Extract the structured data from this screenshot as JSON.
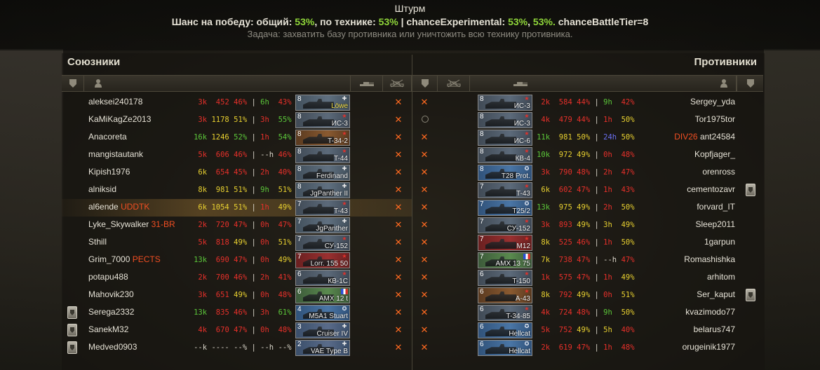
{
  "header": {
    "title": "Штурм",
    "chance_label": "Шанс на победу: общий:",
    "chance_general": "53%",
    "chance_tech_label": ", по технике:",
    "chance_tech": "53%",
    "chance_sep": "| chanceExperimental:",
    "chance_exp1": "53%",
    "chance_comma": ",",
    "chance_exp2": "53%.",
    "chance_tier": "chanceBattleTier=8",
    "task": "Задача: захватить базу противника или уничтожить всю технику противника."
  },
  "teams": {
    "allies_title": "Союзники",
    "enemies_title": "Противники"
  },
  "allies": [
    {
      "name": "aleksei240178",
      "clan": "",
      "battles": "3k",
      "eff": "452",
      "wr": "46%",
      "sep": "|",
      "tb": "6h",
      "twr": "43%",
      "c": [
        "s-red",
        "s-red",
        "s-red",
        "s-green",
        "s-red"
      ],
      "tier": "8",
      "tank": "Löwe",
      "nation": "ger",
      "gold": true,
      "medal": false
    },
    {
      "name": "KaMiKagZe2013",
      "clan": "",
      "battles": "3k",
      "eff": "1178",
      "wr": "51%",
      "sep": "|",
      "tb": "3h",
      "twr": "55%",
      "c": [
        "s-red",
        "s-yellow",
        "s-yellow",
        "s-red",
        "s-green"
      ],
      "tier": "8",
      "tank": "ИС-3",
      "nation": "ussr",
      "gold": false,
      "medal": false
    },
    {
      "name": "Anacoreta",
      "clan": "",
      "battles": "16k",
      "eff": "1246",
      "wr": "52%",
      "sep": "|",
      "tb": "1h",
      "twr": "54%",
      "c": [
        "s-green",
        "s-yellow",
        "s-green",
        "s-red",
        "s-green"
      ],
      "tier": "8",
      "tank": "T-34-2",
      "nation": "chn",
      "gold": false,
      "medal": false
    },
    {
      "name": "mangistautank",
      "clan": "",
      "battles": "5k",
      "eff": "606",
      "wr": "46%",
      "sep": "|",
      "tb": "--h",
      "twr": "46%",
      "c": [
        "s-red",
        "s-red",
        "s-red",
        "s-white",
        "s-red"
      ],
      "tier": "8",
      "tank": "T-44",
      "nation": "ussr",
      "gold": false,
      "medal": false
    },
    {
      "name": "Kipish1976",
      "clan": "",
      "battles": "6k",
      "eff": "654",
      "wr": "45%",
      "sep": "|",
      "tb": "2h",
      "twr": "40%",
      "c": [
        "s-yellow",
        "s-red",
        "s-red",
        "s-red",
        "s-red"
      ],
      "tier": "8",
      "tank": "Ferdinand",
      "nation": "ger",
      "gold": false,
      "medal": false
    },
    {
      "name": "alniksid",
      "clan": "",
      "battles": "8k",
      "eff": "981",
      "wr": "51%",
      "sep": "|",
      "tb": "9h",
      "twr": "51%",
      "c": [
        "s-yellow",
        "s-yellow",
        "s-yellow",
        "s-green",
        "s-yellow"
      ],
      "tier": "8",
      "tank": "JgPanther II",
      "nation": "ger",
      "gold": false,
      "medal": false
    },
    {
      "name": "al6ende",
      "clan": "UDDTK",
      "battles": "6k",
      "eff": "1054",
      "wr": "51%",
      "sep": "|",
      "tb": "1h",
      "twr": "49%",
      "c": [
        "s-yellow",
        "s-yellow",
        "s-yellow",
        "s-red",
        "s-yellow"
      ],
      "tier": "7",
      "tank": "T-43",
      "nation": "ussr",
      "gold": false,
      "medal": false,
      "highlight": true
    },
    {
      "name": "Lyke_Skywalker",
      "clan": "31-BR",
      "battles": "2k",
      "eff": "720",
      "wr": "47%",
      "sep": "|",
      "tb": "0h",
      "twr": "47%",
      "c": [
        "s-red",
        "s-red",
        "s-red",
        "s-red",
        "s-red"
      ],
      "tier": "7",
      "tank": "JgPanther",
      "nation": "ger",
      "gold": false,
      "medal": false
    },
    {
      "name": "Sthill",
      "clan": "",
      "battles": "5k",
      "eff": "818",
      "wr": "49%",
      "sep": "|",
      "tb": "0h",
      "twr": "51%",
      "c": [
        "s-red",
        "s-red",
        "s-yellow",
        "s-red",
        "s-yellow"
      ],
      "tier": "7",
      "tank": "СУ-152",
      "nation": "ussr",
      "gold": false,
      "medal": false
    },
    {
      "name": "Grim_7000",
      "clan": "PECTS",
      "battles": "13k",
      "eff": "690",
      "wr": "47%",
      "sep": "|",
      "tb": "0h",
      "twr": "49%",
      "c": [
        "s-green",
        "s-red",
        "s-red",
        "s-red",
        "s-yellow"
      ],
      "tier": "7",
      "tank": "Lorr. 155 50",
      "nation": "jpn",
      "gold": false,
      "medal": false
    },
    {
      "name": "potapu488",
      "clan": "",
      "battles": "2k",
      "eff": "700",
      "wr": "46%",
      "sep": "|",
      "tb": "2h",
      "twr": "41%",
      "c": [
        "s-red",
        "s-red",
        "s-red",
        "s-red",
        "s-red"
      ],
      "tier": "6",
      "tank": "КВ-1С",
      "nation": "ussr",
      "gold": false,
      "medal": false
    },
    {
      "name": "Mahovik230",
      "clan": "",
      "battles": "3k",
      "eff": "651",
      "wr": "49%",
      "sep": "|",
      "tb": "0h",
      "twr": "48%",
      "c": [
        "s-red",
        "s-red",
        "s-yellow",
        "s-red",
        "s-red"
      ],
      "tier": "6",
      "tank": "AMX 12 t",
      "nation": "fra",
      "gold": false,
      "medal": false
    },
    {
      "name": "Serega2332",
      "clan": "",
      "battles": "13k",
      "eff": "835",
      "wr": "46%",
      "sep": "|",
      "tb": "3h",
      "twr": "61%",
      "c": [
        "s-green",
        "s-red",
        "s-red",
        "s-red",
        "s-green"
      ],
      "tier": "4",
      "tank": "M5A1 Stuart",
      "nation": "usa",
      "gold": false,
      "medal": true
    },
    {
      "name": "SanekM32",
      "clan": "",
      "battles": "4k",
      "eff": "670",
      "wr": "47%",
      "sep": "|",
      "tb": "0h",
      "twr": "48%",
      "c": [
        "s-red",
        "s-red",
        "s-red",
        "s-red",
        "s-red"
      ],
      "tier": "3",
      "tank": "Cruiser IV",
      "nation": "uk",
      "gold": false,
      "medal": true
    },
    {
      "name": "Medved0903",
      "clan": "",
      "battles": "--k",
      "eff": "----",
      "wr": "--%",
      "sep": "|",
      "tb": "--h",
      "twr": "--%",
      "c": [
        "s-white",
        "s-white",
        "s-white",
        "s-white",
        "s-white"
      ],
      "tier": "2",
      "tank": "VAE Type B",
      "nation": "uk",
      "gold": false,
      "medal": true
    }
  ],
  "enemies": [
    {
      "name": "Sergey_yda",
      "battles": "2k",
      "eff": "584",
      "wr": "44%",
      "sep": "|",
      "tb": "9h",
      "twr": "42%",
      "c": [
        "s-red",
        "s-red",
        "s-red",
        "s-green",
        "s-red"
      ],
      "tier": "8",
      "tank": "ИС-3",
      "nation": "ussr",
      "status": "x",
      "clan": "",
      "medal": false
    },
    {
      "name": "Tor1975tor",
      "battles": "4k",
      "eff": "479",
      "wr": "44%",
      "sep": "|",
      "tb": "1h",
      "twr": "50%",
      "c": [
        "s-red",
        "s-red",
        "s-red",
        "s-red",
        "s-yellow"
      ],
      "tier": "8",
      "tank": "ИС-3",
      "nation": "ussr",
      "status": "o",
      "clan": "",
      "medal": false
    },
    {
      "name": "ant24584",
      "battles": "11k",
      "eff": "981",
      "wr": "50%",
      "sep": "|",
      "tb": "24h",
      "twr": "50%",
      "c": [
        "s-green",
        "s-yellow",
        "s-yellow",
        "s-blue",
        "s-yellow"
      ],
      "tier": "8",
      "tank": "ИС-6",
      "nation": "ussr",
      "status": "x",
      "clan": "DIV26",
      "medal": false
    },
    {
      "name": "Kopfjager_",
      "battles": "10k",
      "eff": "972",
      "wr": "49%",
      "sep": "|",
      "tb": "0h",
      "twr": "48%",
      "c": [
        "s-green",
        "s-yellow",
        "s-yellow",
        "s-red",
        "s-red"
      ],
      "tier": "8",
      "tank": "КВ-4",
      "nation": "ussr",
      "status": "x",
      "clan": "",
      "medal": false
    },
    {
      "name": "orenross",
      "battles": "3k",
      "eff": "790",
      "wr": "48%",
      "sep": "|",
      "tb": "2h",
      "twr": "47%",
      "c": [
        "s-red",
        "s-red",
        "s-red",
        "s-red",
        "s-red"
      ],
      "tier": "8",
      "tank": "T28 Prot.",
      "nation": "usa",
      "status": "x",
      "clan": "",
      "medal": false
    },
    {
      "name": "cementozavr",
      "battles": "6k",
      "eff": "602",
      "wr": "47%",
      "sep": "|",
      "tb": "1h",
      "twr": "43%",
      "c": [
        "s-yellow",
        "s-red",
        "s-red",
        "s-red",
        "s-red"
      ],
      "tier": "7",
      "tank": "T-43",
      "nation": "ussr",
      "status": "x",
      "clan": "",
      "medal": true
    },
    {
      "name": "forvard_IT",
      "battles": "13k",
      "eff": "975",
      "wr": "49%",
      "sep": "|",
      "tb": "2h",
      "twr": "50%",
      "c": [
        "s-green",
        "s-yellow",
        "s-yellow",
        "s-red",
        "s-yellow"
      ],
      "tier": "7",
      "tank": "T25/2",
      "nation": "usa",
      "status": "x",
      "clan": "",
      "medal": false
    },
    {
      "name": "Sleep2011",
      "battles": "3k",
      "eff": "893",
      "wr": "49%",
      "sep": "|",
      "tb": "3h",
      "twr": "49%",
      "c": [
        "s-red",
        "s-red",
        "s-yellow",
        "s-yellow",
        "s-yellow"
      ],
      "tier": "7",
      "tank": "СУ-152",
      "nation": "ussr",
      "status": "x",
      "clan": "",
      "medal": false
    },
    {
      "name": "1garpun",
      "battles": "8k",
      "eff": "525",
      "wr": "46%",
      "sep": "|",
      "tb": "1h",
      "twr": "50%",
      "c": [
        "s-yellow",
        "s-red",
        "s-red",
        "s-red",
        "s-yellow"
      ],
      "tier": "7",
      "tank": "M12",
      "nation": "jpn",
      "status": "x",
      "clan": "",
      "medal": false
    },
    {
      "name": "Romashishka",
      "battles": "7k",
      "eff": "738",
      "wr": "47%",
      "sep": "|",
      "tb": "--h",
      "twr": "47%",
      "c": [
        "s-yellow",
        "s-red",
        "s-red",
        "s-white",
        "s-red"
      ],
      "tier": "7",
      "tank": "AMX 13 75",
      "nation": "fra",
      "status": "x",
      "clan": "",
      "medal": false
    },
    {
      "name": "arhitom",
      "battles": "1k",
      "eff": "575",
      "wr": "47%",
      "sep": "|",
      "tb": "1h",
      "twr": "49%",
      "c": [
        "s-red",
        "s-red",
        "s-red",
        "s-red",
        "s-yellow"
      ],
      "tier": "6",
      "tank": "T-150",
      "nation": "ussr",
      "status": "x",
      "clan": "",
      "medal": false
    },
    {
      "name": "Ser_kaput",
      "battles": "8k",
      "eff": "792",
      "wr": "49%",
      "sep": "|",
      "tb": "0h",
      "twr": "51%",
      "c": [
        "s-yellow",
        "s-red",
        "s-yellow",
        "s-red",
        "s-yellow"
      ],
      "tier": "6",
      "tank": "A-43",
      "nation": "chn",
      "status": "x",
      "clan": "",
      "medal": true
    },
    {
      "name": "kvazimodo77",
      "battles": "4k",
      "eff": "724",
      "wr": "48%",
      "sep": "|",
      "tb": "9h",
      "twr": "50%",
      "c": [
        "s-red",
        "s-red",
        "s-red",
        "s-green",
        "s-yellow"
      ],
      "tier": "6",
      "tank": "T-34-85",
      "nation": "ussr",
      "status": "x",
      "clan": "",
      "medal": false
    },
    {
      "name": "belarus747",
      "battles": "5k",
      "eff": "752",
      "wr": "49%",
      "sep": "|",
      "tb": "5h",
      "twr": "40%",
      "c": [
        "s-red",
        "s-red",
        "s-yellow",
        "s-yellow",
        "s-red"
      ],
      "tier": "6",
      "tank": "Hellcat",
      "nation": "usa",
      "status": "x",
      "clan": "",
      "medal": false
    },
    {
      "name": "orugeinik1977",
      "battles": "2k",
      "eff": "619",
      "wr": "47%",
      "sep": "|",
      "tb": "1h",
      "twr": "48%",
      "c": [
        "s-red",
        "s-red",
        "s-red",
        "s-red",
        "s-red"
      ],
      "tier": "6",
      "tank": "Hellcat",
      "nation": "usa",
      "status": "x",
      "clan": "",
      "medal": false
    }
  ],
  "colors": {
    "accent_green": "#8fd53a",
    "stat_red": "#e8302a",
    "stat_green": "#5cc83a",
    "stat_yellow": "#e8d030",
    "clan_red": "#f04e22",
    "dead_x": "#ff6a20"
  }
}
